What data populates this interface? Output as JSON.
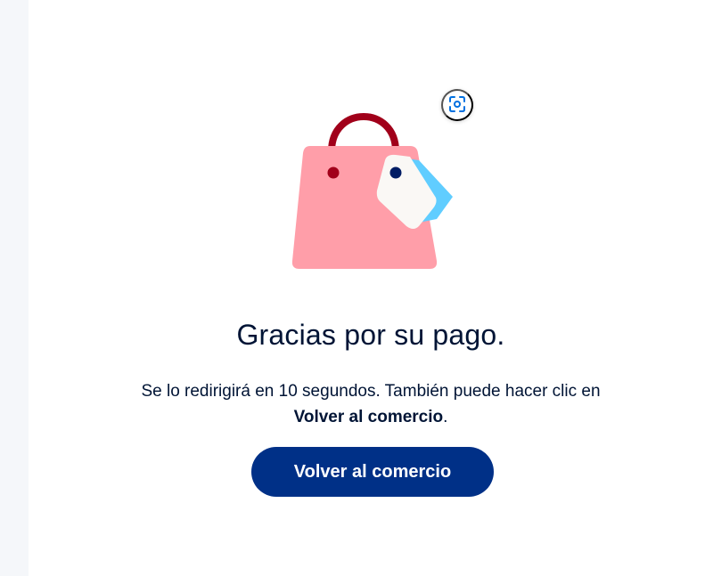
{
  "confirmation": {
    "title": "Gracias por su pago.",
    "message_prefix": "Se lo redirigirá en 10 segundos. También puede hacer clic en",
    "message_link": "Volver al comercio",
    "message_suffix": ".",
    "button_label": "Volver al comercio"
  },
  "icons": {
    "scan": "scan-qr-icon",
    "illustration": "shopping-bag-with-tag-illustration"
  },
  "colors": {
    "text": "#001435",
    "button_bg": "#003087",
    "bag_body": "#FF9EA9",
    "bag_handle": "#A1001A",
    "tag_front": "#FAF8F5",
    "tag_back": "#60CDFF",
    "tag_dot": "#001C64",
    "scan_icon": "#0070E0"
  }
}
